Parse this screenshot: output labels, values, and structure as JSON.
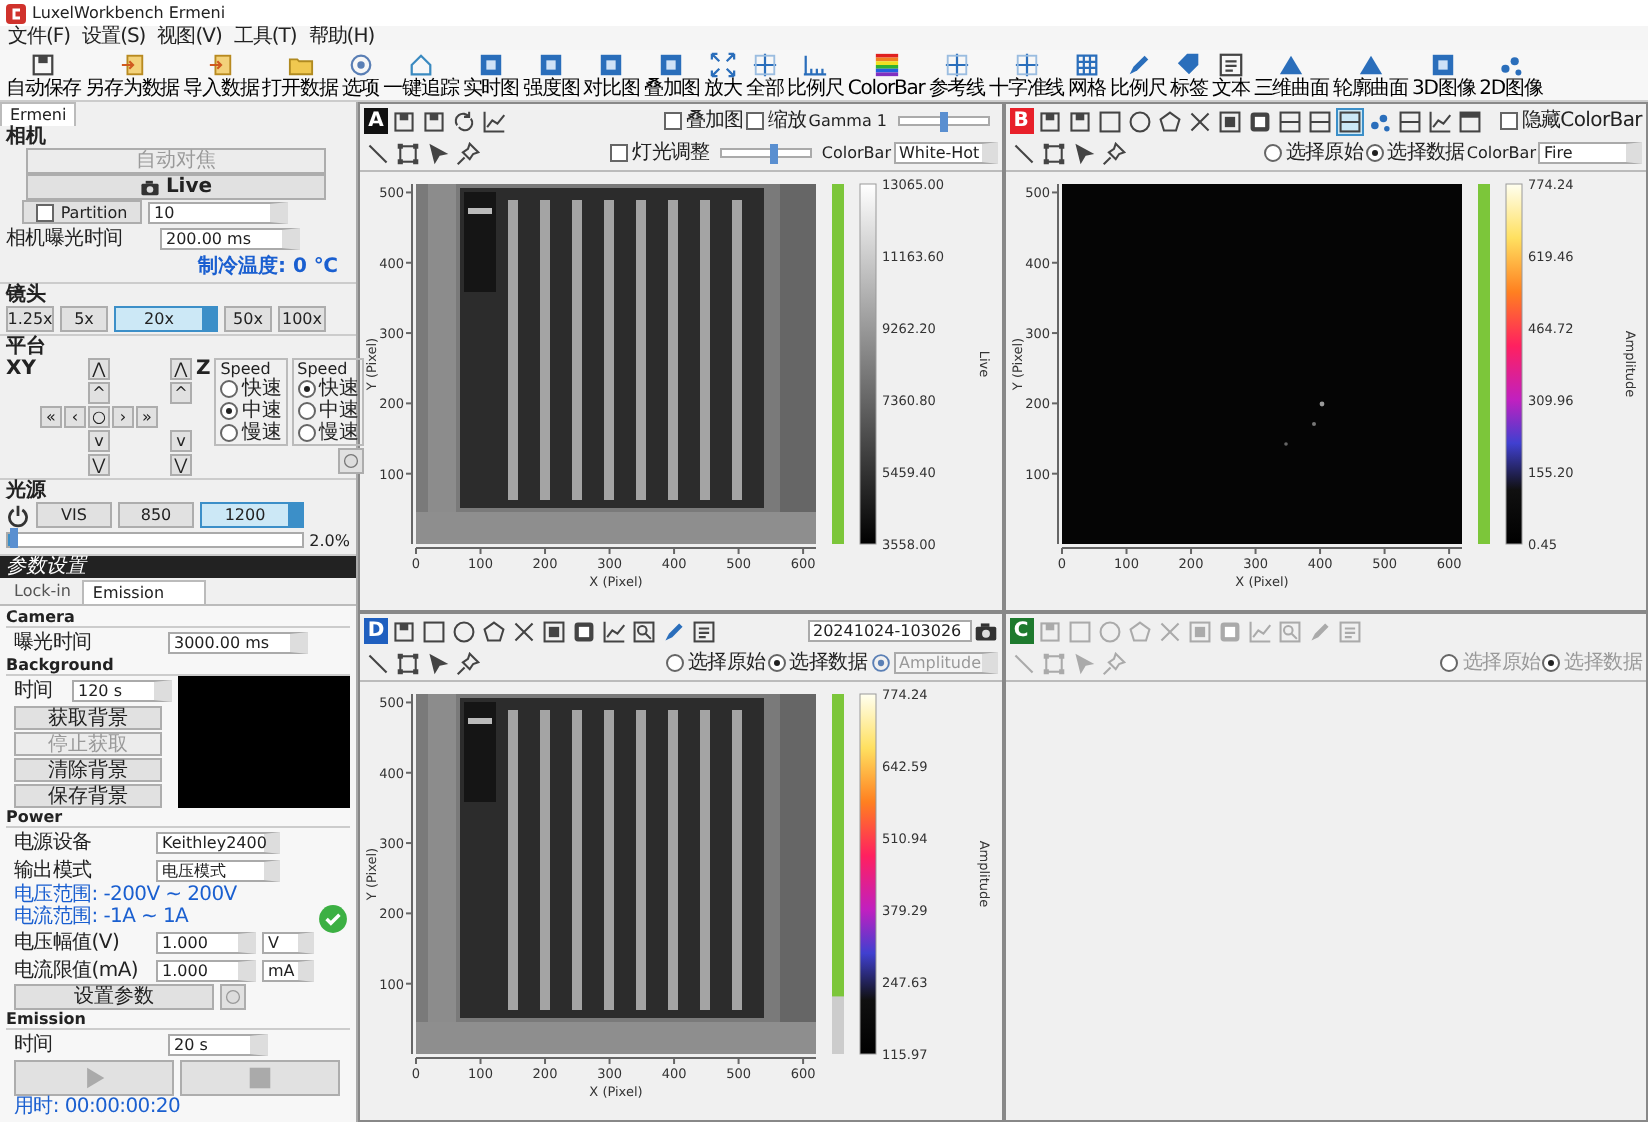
{
  "window": {
    "title": "LuxelWorkbench Ermeni"
  },
  "menu": [
    "文件(F)",
    "设置(S)",
    "视图(V)",
    "工具(T)",
    "帮助(H)"
  ],
  "toolbar": [
    {
      "kind": "disk",
      "label": "自动保存"
    },
    {
      "kind": "import",
      "label": "另存为数据"
    },
    {
      "kind": "import",
      "label": "导入数据"
    },
    {
      "kind": "folder",
      "label": "打开数据"
    },
    {
      "kind": "gear",
      "label": "选项"
    },
    {
      "kind": "home",
      "label": "一键追踪"
    },
    {
      "kind": "tile",
      "label": "实时图"
    },
    {
      "kind": "tile",
      "label": "强度图"
    },
    {
      "kind": "tile",
      "label": "对比图"
    },
    {
      "kind": "tile",
      "label": "叠加图"
    },
    {
      "kind": "expand",
      "label": "放大"
    },
    {
      "kind": "cross",
      "label": "全部"
    },
    {
      "kind": "ruler",
      "label": "比例尺"
    },
    {
      "kind": "palette",
      "label": "ColorBar"
    },
    {
      "kind": "cross",
      "label": "参考线"
    },
    {
      "kind": "cross",
      "label": "十字准线"
    },
    {
      "kind": "grid",
      "label": "网格"
    },
    {
      "kind": "pen",
      "label": "比例尺"
    },
    {
      "kind": "tag",
      "label": "标签"
    },
    {
      "kind": "text",
      "label": "文本"
    },
    {
      "kind": "peak",
      "label": "三维曲面"
    },
    {
      "kind": "peak",
      "label": "轮廓曲面"
    },
    {
      "kind": "tile",
      "label": "3D图像"
    },
    {
      "kind": "dots",
      "label": "2D图像"
    }
  ],
  "left": {
    "tab": "Ermeni",
    "camera": {
      "heading": "相机",
      "autofocus": {
        "label": "自动对焦",
        "disabled": true
      },
      "live": "Live",
      "partition": {
        "label": "Partition",
        "checked": false
      },
      "partition_value": "10",
      "exposure_label": "相机曝光时间",
      "exposure_value": "200.00 ms",
      "temperature": "制冷温度: 0 ℃"
    },
    "lens": {
      "heading": "镜头",
      "buttons": [
        {
          "label": "1.25x",
          "selected": false
        },
        {
          "label": "5x",
          "selected": false
        },
        {
          "label": "20x",
          "selected": true
        },
        {
          "label": "50x",
          "selected": false
        },
        {
          "label": "100x",
          "selected": false
        }
      ]
    },
    "stage": {
      "heading": "平台",
      "xy_label": "XY",
      "z_label": "Z",
      "xy_pad": [
        [
          "⋀"
        ],
        [
          "^"
        ],
        [
          "«",
          "‹",
          "○",
          "›",
          "»"
        ],
        [
          "v"
        ],
        [
          "⋁"
        ]
      ],
      "z_pad": [
        "⋀",
        "^",
        "v",
        "⋁"
      ],
      "speeds": [
        {
          "title": "Speed",
          "options": [
            {
              "label": "快速",
              "selected": false
            },
            {
              "label": "中速",
              "selected": true
            },
            {
              "label": "慢速",
              "selected": false
            }
          ]
        },
        {
          "title": "Speed",
          "options": [
            {
              "label": "快速",
              "selected": true
            },
            {
              "label": "中速",
              "selected": false
            },
            {
              "label": "慢速",
              "selected": false
            }
          ]
        }
      ]
    },
    "light": {
      "heading": "光源",
      "buttons": [
        {
          "label": "VIS",
          "selected": false
        },
        {
          "label": "850",
          "selected": false
        },
        {
          "label": "1200",
          "selected": true
        }
      ],
      "level": 0.02,
      "reading": "2.0%"
    }
  },
  "params": {
    "title": "参数设置",
    "tabs": [
      {
        "label": "Lock-in",
        "selected": false
      },
      {
        "label": "Emission",
        "selected": true
      }
    ],
    "camera": {
      "heading": "Camera",
      "exposure_label": "曝光时间",
      "exposure_value": "3000.00 ms"
    },
    "background": {
      "heading": "Background",
      "time_label": "时间",
      "time_value": "120 s",
      "buttons": [
        {
          "label": "获取背景",
          "disabled": false
        },
        {
          "label": "停止获取",
          "disabled": true
        },
        {
          "label": "清除背景",
          "disabled": false
        },
        {
          "label": "保存背景",
          "disabled": false
        }
      ]
    },
    "power": {
      "heading": "Power",
      "device_label": "电源设备",
      "device_value": "Keithley2400",
      "mode_label": "输出模式",
      "mode_value": "电压模式",
      "voltage_range": "电压范围: -200V ~ 200V",
      "current_range": "电流范围: -1A ~ 1A",
      "voltage_label": "电压幅值(V)",
      "voltage_value": "1.000",
      "voltage_unit": "V",
      "current_label": "电流限值(mA)",
      "current_value": "1.000",
      "current_unit": "mA",
      "set_button": "设置参数",
      "ready": true
    },
    "emission": {
      "heading": "Emission",
      "time_label": "时间",
      "time_value": "20 s",
      "elapsed": "用时: 00:00:00:20"
    }
  },
  "panels": [
    {
      "letter": "A",
      "color": "#111111",
      "disabled": false,
      "tools": [
        {
          "kind": "disk"
        },
        {
          "kind": "disk"
        },
        {
          "kind": "rotate"
        },
        {
          "kind": "chart"
        }
      ],
      "options1": [
        {
          "kind": "checkbox",
          "label": "叠加图",
          "checked": false
        },
        {
          "kind": "checkbox",
          "label": "缩放",
          "checked": false
        },
        {
          "kind": "label",
          "text": "Gamma 1"
        },
        {
          "kind": "slider",
          "level": 0.5
        }
      ],
      "options2": [
        {
          "kind": "checkbox",
          "label": "灯光调整",
          "checked": false
        },
        {
          "kind": "slider",
          "level": 0.6
        },
        {
          "kind": "label",
          "text": "ColorBar"
        },
        {
          "kind": "select",
          "value": "White-Hot",
          "disabled": false
        }
      ],
      "plot": {
        "xticks": [
          "0",
          "100",
          "200",
          "300",
          "400",
          "500",
          "600"
        ],
        "yticks": [
          "500",
          "400",
          "300",
          "200",
          "100"
        ],
        "xlabel": "X (Pixel)",
        "ylabel": "Y (Pixel)",
        "range": {
          "level": 1
        },
        "colorbar": {
          "kind": "gray",
          "ticks": [
            "13065.00",
            "11163.60",
            "9262.20",
            "7360.80",
            "5459.40",
            "3558.00"
          ],
          "label": "Live"
        }
      }
    },
    {
      "letter": "B",
      "kind": "map",
      "color": "#e8202a",
      "disabled": false,
      "tools": [
        {
          "kind": "disk",
          "selected": false
        },
        {
          "kind": "disk",
          "selected": false
        },
        {
          "kind": "rect",
          "selected": false
        },
        {
          "kind": "circle",
          "selected": false
        },
        {
          "kind": "pentagon",
          "selected": false
        },
        {
          "kind": "xmark",
          "selected": false
        },
        {
          "kind": "filled",
          "selected": false
        },
        {
          "kind": "frame",
          "selected": false
        },
        {
          "kind": "hline",
          "selected": false
        },
        {
          "kind": "hline",
          "selected": false
        },
        {
          "kind": "hline",
          "selected": true
        },
        {
          "kind": "dots",
          "selected": false
        },
        {
          "kind": "hline",
          "selected": false
        },
        {
          "kind": "chart",
          "selected": false
        },
        {
          "kind": "window",
          "selected": false
        }
      ],
      "options1": [
        {
          "kind": "checkbox",
          "label": "隐藏ColorBar",
          "checked": false
        }
      ],
      "options2": [
        {
          "kind": "radio",
          "label": "选择原始",
          "selected": false
        },
        {
          "kind": "radio",
          "label": "选择数据",
          "selected": true
        },
        {
          "kind": "label",
          "text": "ColorBar"
        },
        {
          "kind": "select",
          "value": "Fire",
          "disabled": false
        }
      ],
      "plot": {
        "xticks": [
          "0",
          "100",
          "200",
          "300",
          "400",
          "500",
          "600"
        ],
        "yticks": [
          "500",
          "400",
          "300",
          "200",
          "100"
        ],
        "xlabel": "X (Pixel)",
        "ylabel": "Y (Pixel)",
        "range": {
          "level": 1
        },
        "colorbar": {
          "kind": "fire",
          "ticks": [
            "774.24",
            "619.46",
            "464.72",
            "309.96",
            "155.20",
            "0.45"
          ],
          "label": "Amplitude"
        }
      }
    },
    {
      "letter": "D",
      "color": "#1f5fbf",
      "disabled": false,
      "tools": [
        {
          "kind": "disk"
        },
        {
          "kind": "rect"
        },
        {
          "kind": "circle"
        },
        {
          "kind": "pentagon"
        },
        {
          "kind": "xmark"
        },
        {
          "kind": "filled"
        },
        {
          "kind": "frame"
        },
        {
          "kind": "chart"
        },
        {
          "kind": "zoom"
        },
        {
          "kind": "pen"
        },
        {
          "kind": "text"
        }
      ],
      "options1": [
        {
          "kind": "field",
          "value": "20241024-103026"
        },
        {
          "kind": "camera"
        }
      ],
      "options2": [
        {
          "kind": "radio",
          "label": "选择原始",
          "selected": false
        },
        {
          "kind": "radio",
          "label": "选择数据",
          "selected": true
        },
        {
          "kind": "gear"
        },
        {
          "kind": "select",
          "value": "Amplitude",
          "disabled": true
        }
      ],
      "plot": {
        "xticks": [
          "0",
          "100",
          "200",
          "300",
          "400",
          "500",
          "600"
        ],
        "yticks": [
          "500",
          "400",
          "300",
          "200",
          "100"
        ],
        "xlabel": "X (Pixel)",
        "ylabel": "Y (Pixel)",
        "range": {
          "level": 0.84
        },
        "colorbar": {
          "kind": "fire",
          "ticks": [
            "774.24",
            "642.59",
            "510.94",
            "379.29",
            "247.63",
            "115.97"
          ],
          "label": "Amplitude"
        }
      }
    },
    {
      "letter": "C",
      "color": "#1e7a2e",
      "disabled": true,
      "tools": [
        {
          "kind": "disk"
        },
        {
          "kind": "rect"
        },
        {
          "kind": "circle"
        },
        {
          "kind": "pentagon"
        },
        {
          "kind": "xmark"
        },
        {
          "kind": "filled"
        },
        {
          "kind": "frame"
        },
        {
          "kind": "chart"
        },
        {
          "kind": "zoom"
        },
        {
          "kind": "pen"
        },
        {
          "kind": "text"
        }
      ],
      "options2": [
        {
          "kind": "radio",
          "label": "选择原始",
          "selected": false
        },
        {
          "kind": "radio",
          "label": "选择数据",
          "selected": true
        }
      ]
    }
  ]
}
